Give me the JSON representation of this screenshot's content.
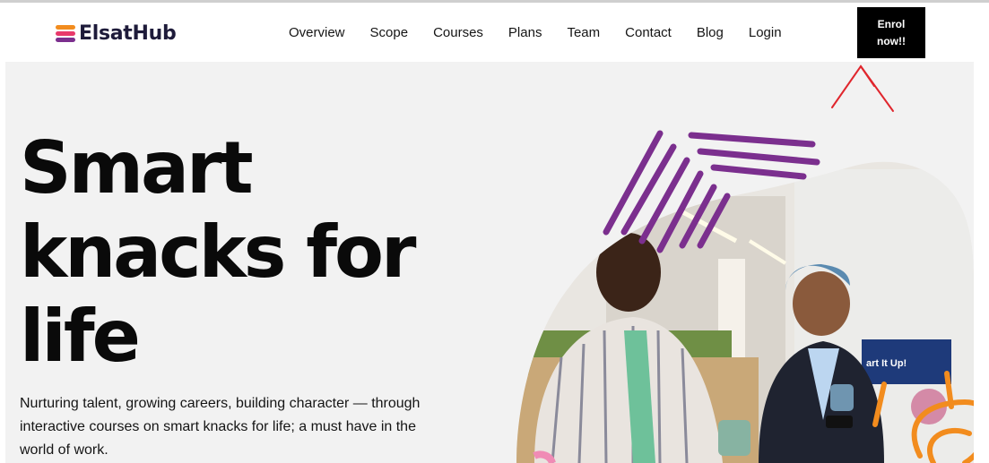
{
  "brand": {
    "name": "ElsatHub",
    "colors": [
      "#7b2f8e",
      "#e8396b",
      "#f28c1e"
    ]
  },
  "nav": {
    "items": [
      "Overview",
      "Scope",
      "Courses",
      "Plans",
      "Team",
      "Contact",
      "Blog",
      "Login"
    ]
  },
  "cta": {
    "line1": "Enrol",
    "line2": "now!!"
  },
  "hero": {
    "headline": [
      "Smart",
      "knacks for",
      "life"
    ],
    "tagline": "Nurturing talent, growing careers, building character — through interactive courses on smart knacks for life; a must have in the world of work.",
    "photo_sign_text": "art It Up!"
  },
  "colors": {
    "accent_purple": "#7b2f8e",
    "accent_orange": "#f28c1e",
    "annotation_red": "#e0262d"
  }
}
